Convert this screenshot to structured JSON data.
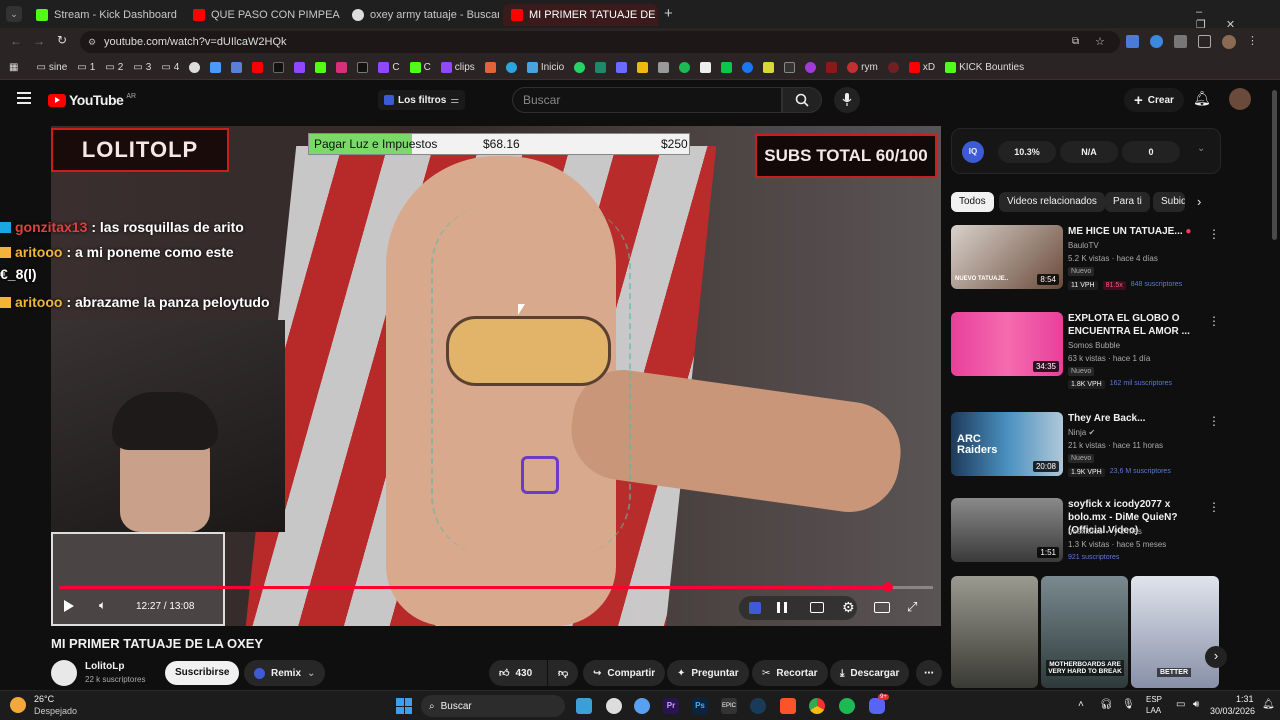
{
  "browser": {
    "tabs": [
      {
        "title": "Stream - Kick Dashboard",
        "color": "#53fc18"
      },
      {
        "title": "QUE PASO CON PIMPEANO? -",
        "color": "#ff0000"
      },
      {
        "title": "oxey army tatuaje - Buscar con",
        "color": "#dddddd"
      },
      {
        "title": "MI PRIMER TATUAJE DE LA OXE",
        "color": "#ff0000"
      }
    ],
    "new_tab": "+",
    "url": "youtube.com/watch?v=dUIlcaW2HQk",
    "bookmarks": [
      "sine",
      "1",
      "2",
      "3",
      "4",
      "C",
      "C",
      "clips",
      "Inicio",
      "rym",
      "xD",
      "KICK Bounties"
    ]
  },
  "youtube": {
    "logo": "YouTube",
    "region": "AR",
    "filters_label": "Los filtros",
    "search_placeholder": "Buscar",
    "create_label": "Crear"
  },
  "overlay": {
    "channel_banner": "LOLITOLP",
    "goal_label": "Pagar Luz e Impuestos",
    "goal_current": "$68.16",
    "goal_target": "$250",
    "goal_progress": 0.27,
    "subs_text": "SUBS TOTAL 60/100",
    "chat": [
      {
        "user": "gonzitax13",
        "text": ": las rosquillas de arito",
        "color": "#e04040"
      },
      {
        "user": "aritooo",
        "text": ": a mi poneme como este",
        "color": "#f2b43a"
      },
      {
        "user": "",
        "text": "€_8(l)",
        "color": "#ffffff"
      },
      {
        "user": "aritooo",
        "text": ": abrazame la panza peloytudo",
        "color": "#f2b43a"
      }
    ]
  },
  "player": {
    "time": "12:27 / 13:08",
    "progress": 0.948
  },
  "video": {
    "title": "MI PRIMER TATUAJE DE LA OXEY",
    "channel": "LolitoLp",
    "subscribers": "22 k suscriptores",
    "subscribe_label": "Suscribirse",
    "remix_label": "Remix",
    "likes": "430",
    "share_label": "Compartir",
    "ask_label": "Preguntar",
    "clip_label": "Recortar",
    "download_label": "Descargar"
  },
  "extension": {
    "stat1": "10.3%",
    "stat2": "N/A",
    "stat3": "0"
  },
  "sidebar": {
    "chips": [
      "Todos",
      "Videos relacionados",
      "Para ti",
      "Subid"
    ],
    "videos": [
      {
        "title": "ME HICE UN TATUAJE...",
        "channel": "BauloTV",
        "meta": "5.2 K vistas · hace 4 días",
        "badge": "Nuevo",
        "vph": "11 VPH",
        "mult": "81.5x",
        "subs": "848 suscriptores",
        "duration": "8:54",
        "thumb_caption": "NUEVO TATUAJE..",
        "thumb_color": "#6b4a3a"
      },
      {
        "title": "EXPLOTA EL GLOBO O ENCUENTRA EL AMOR ...",
        "channel": "Somos Bubble",
        "meta": "63 k vistas · hace 1 día",
        "badge": "Nuevo",
        "vph": "1.8K VPH",
        "mult": "",
        "subs": "162 mil suscriptores",
        "duration": "34:35",
        "thumb_caption": "",
        "thumb_color": "#d9468a"
      },
      {
        "title": "They Are Back...",
        "channel": "Ninja",
        "meta": "21 k vistas · hace 11 horas",
        "badge": "Nuevo",
        "vph": "1.9K VPH",
        "mult": "",
        "subs": "23,6 M suscriptores",
        "duration": "20:08",
        "thumb_caption": "ARC Raiders",
        "thumb_color": "#2d5a8a"
      },
      {
        "title": "soyfick x icody2077 x bolo.mx - DiMe QuieN? (Official Video)",
        "channel": "noexitooo",
        "meta": "1.3 K vistas · hace 5 meses",
        "badge": "",
        "vph": "",
        "mult": "",
        "subs": "921 suscriptores",
        "duration": "1:51",
        "thumb_caption": "",
        "thumb_color": "#5a5a5a"
      }
    ],
    "shorts": [
      "",
      "MOTHERBOARDS ARE VERY HARD TO BREAK",
      "BETTER"
    ]
  },
  "taskbar": {
    "weather_temp": "26°C",
    "weather_desc": "Despejado",
    "search_label": "Buscar",
    "lang": "ESP",
    "lang2": "LAA",
    "time": "1:31",
    "date": "30/03/2026",
    "notif": "9+"
  }
}
